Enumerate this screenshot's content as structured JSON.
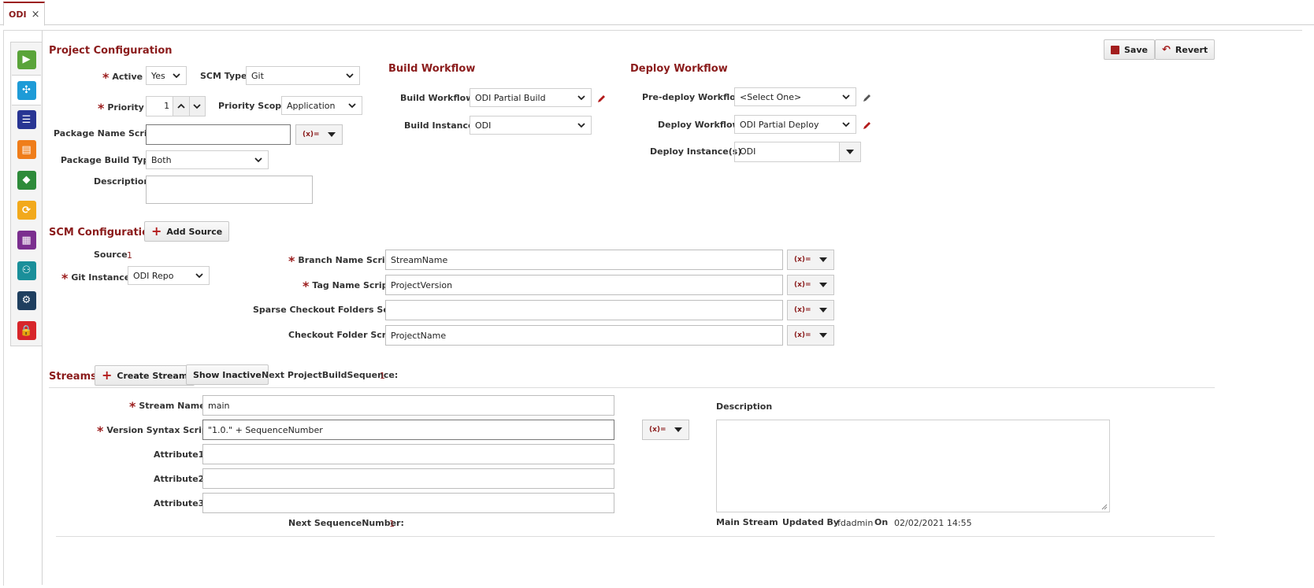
{
  "tab": {
    "label": "ODI",
    "close": "×"
  },
  "sidebar": {
    "items": [
      {
        "icon": "play-gear-icon",
        "color": "#5aa43a",
        "glyph": "▶"
      },
      {
        "icon": "workflow-icon",
        "color": "#1e9bd7",
        "glyph": "✣"
      },
      {
        "icon": "list-icon",
        "color": "#283593",
        "glyph": "☰"
      },
      {
        "icon": "document-icon",
        "color": "#ef7d1a",
        "glyph": "▤"
      },
      {
        "icon": "package-icon",
        "color": "#2e8b3a",
        "glyph": "◆"
      },
      {
        "icon": "refresh-icon",
        "color": "#f2a91c",
        "glyph": "⟳"
      },
      {
        "icon": "report-icon",
        "color": "#7b2f8f",
        "glyph": "▦"
      },
      {
        "icon": "network-icon",
        "color": "#1a8f9a",
        "glyph": "⚇"
      },
      {
        "icon": "robot-icon",
        "color": "#1f3f5f",
        "glyph": "⚙"
      },
      {
        "icon": "lock-icon",
        "color": "#d7262b",
        "glyph": "🔒"
      }
    ]
  },
  "toolbar": {
    "save": "Save",
    "revert": "Revert"
  },
  "project": {
    "title": "Project Configuration",
    "active_label": "Active",
    "active_value": "Yes",
    "scm_type_label": "SCM Type",
    "scm_type_value": "Git",
    "priority_label": "Priority",
    "priority_value": "1",
    "priority_scope_label": "Priority Scope",
    "priority_scope_value": "Application",
    "package_name_script_label": "Package Name Script",
    "package_name_script_value": "",
    "fx": "(x)=",
    "package_build_type_label": "Package Build Type",
    "package_build_type_value": "Both",
    "description_label": "Description",
    "description_value": ""
  },
  "build": {
    "title": "Build Workflow",
    "workflow_label": "Build Workflow",
    "workflow_value": "ODI Partial Build",
    "instance_label": "Build Instance",
    "instance_value": "ODI"
  },
  "deploy": {
    "title": "Deploy Workflow",
    "pre_label": "Pre-deploy Workflow",
    "pre_value": "<Select One>",
    "workflow_label": "Deploy Workflow",
    "workflow_value": "ODI Partial Deploy",
    "instances_label": "Deploy Instance(s)",
    "instances_value": "ODI"
  },
  "scm": {
    "title": "SCM Configuration",
    "add_source": "Add Source",
    "source_label": "Source",
    "source_value": "1",
    "git_instance_label": "Git Instance",
    "git_instance_value": "ODI Repo",
    "branch_label": "Branch Name Script",
    "branch_value": "StreamName",
    "tag_label": "Tag Name Script",
    "tag_value": "ProjectVersion",
    "sparse_label": "Sparse Checkout Folders Script",
    "sparse_value": "",
    "checkout_label": "Checkout Folder Script",
    "checkout_value": "ProjectName"
  },
  "streams": {
    "title": "Streams",
    "create": "Create Stream",
    "show_inactive": "Show Inactive",
    "next_pbs_label": "Next ProjectBuildSequence:",
    "next_pbs_value": "1",
    "stream_name_label": "Stream Name",
    "stream_name_value": "main",
    "version_label": "Version Syntax Script",
    "version_value": "\"1.0.\" + SequenceNumber",
    "attr1_label": "Attribute1",
    "attr2_label": "Attribute2",
    "attr3_label": "Attribute3",
    "description_label": "Description",
    "next_seq_label": "Next SequenceNumber:",
    "next_seq_value": "1",
    "main_stream": "Main Stream",
    "updated_by_label": "Updated By",
    "updated_by_value": "fdadmin",
    "on_label": "On",
    "on_value": "02/02/2021 14:55"
  }
}
